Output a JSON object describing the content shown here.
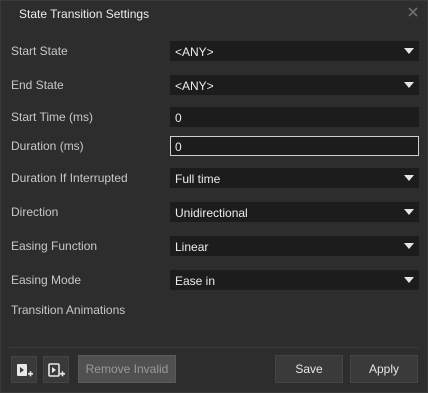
{
  "dialog": {
    "title": "State Transition Settings",
    "close_icon": "close-icon"
  },
  "fields": {
    "start_state": {
      "label": "Start State",
      "value": "<ANY>"
    },
    "end_state": {
      "label": "End State",
      "value": "<ANY>"
    },
    "start_time": {
      "label": "Start Time (ms)",
      "value": "0"
    },
    "duration": {
      "label": "Duration (ms)",
      "value": "0"
    },
    "duration_if_interrupted": {
      "label": "Duration If Interrupted",
      "value": "Full time"
    },
    "direction": {
      "label": "Direction",
      "value": "Unidirectional"
    },
    "easing_function": {
      "label": "Easing Function",
      "value": "Linear"
    },
    "easing_mode": {
      "label": "Easing Mode",
      "value": "Ease in"
    }
  },
  "sections": {
    "transition_animations": "Transition Animations"
  },
  "footer": {
    "add_animation_icon": "add-animation-icon",
    "add_custom_animation_icon": "add-custom-animation-icon",
    "remove_invalid_label": "Remove Invalid",
    "save_label": "Save",
    "apply_label": "Apply"
  },
  "colors": {
    "dialog_bg": "#2d2d2d",
    "field_bg": "#1c1c1c",
    "button_bg": "#3a3a3a",
    "disabled_button_bg": "#505050"
  }
}
